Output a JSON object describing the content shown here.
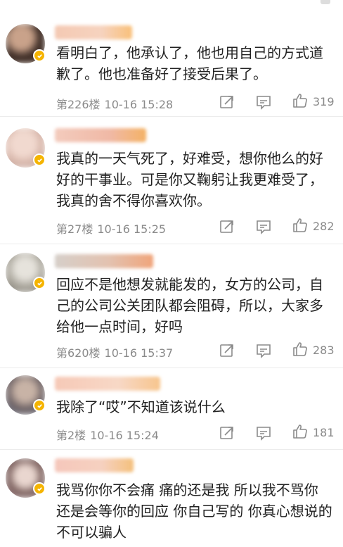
{
  "comments": [
    {
      "text": "看明白了，他承认了，他也用自己的方式道歉了。他也准备好了接受后果了。",
      "floor": "第226楼",
      "time": "10-16 15:28",
      "likes": "319",
      "icons": [
        "avatar",
        "verified-badge-icon",
        "share-icon",
        "comment-icon",
        "thumbs-up-icon"
      ]
    },
    {
      "text": "我真的一天气死了，好难受，想你他么的好好的干事业。可是你又鞠躬让我更难受了，我真的舍不得你喜欢你。",
      "floor": "第27楼",
      "time": "10-16 15:25",
      "likes": "282",
      "icons": [
        "avatar",
        "verified-badge-icon",
        "share-icon",
        "comment-icon",
        "thumbs-up-icon"
      ]
    },
    {
      "text": "回应不是他想发就能发的，女方的公司，自己的公司公关团队都会阻碍，所以，大家多给他一点时间，好吗",
      "floor": "第620楼",
      "time": "10-16 15:37",
      "likes": "283",
      "icons": [
        "avatar",
        "verified-badge-icon",
        "share-icon",
        "comment-icon",
        "thumbs-up-icon"
      ]
    },
    {
      "text": "我除了“哎”不知道该说什么",
      "floor": "第2楼",
      "time": "10-16 15:24",
      "likes": "181",
      "icons": [
        "avatar",
        "verified-badge-icon",
        "share-icon",
        "comment-icon",
        "thumbs-up-icon"
      ]
    },
    {
      "text": "我骂你你不会痛 痛的还是我 所以我不骂你 还是会等你的回应 你自己写的 你真心想说的 不可以骗人",
      "floor": "",
      "time": "",
      "likes": "",
      "icons": [
        "avatar",
        "verified-badge-icon"
      ]
    }
  ],
  "colors": {
    "text": "#222222",
    "meta": "#8a8a8a",
    "badge": "#f5b400",
    "divider": "#ececec"
  }
}
